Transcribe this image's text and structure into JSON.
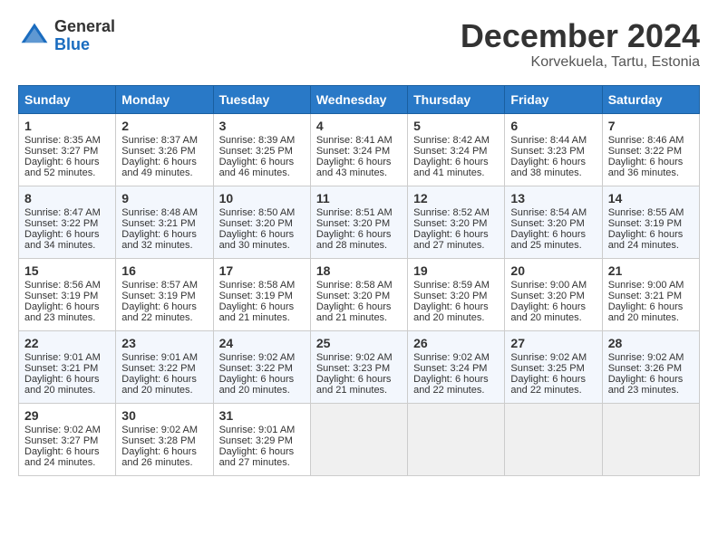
{
  "logo": {
    "general": "General",
    "blue": "Blue"
  },
  "title": "December 2024",
  "location": "Korvekuela, Tartu, Estonia",
  "days_of_week": [
    "Sunday",
    "Monday",
    "Tuesday",
    "Wednesday",
    "Thursday",
    "Friday",
    "Saturday"
  ],
  "weeks": [
    [
      {
        "day": "1",
        "sunrise": "Sunrise: 8:35 AM",
        "sunset": "Sunset: 3:27 PM",
        "daylight": "Daylight: 6 hours and 52 minutes."
      },
      {
        "day": "2",
        "sunrise": "Sunrise: 8:37 AM",
        "sunset": "Sunset: 3:26 PM",
        "daylight": "Daylight: 6 hours and 49 minutes."
      },
      {
        "day": "3",
        "sunrise": "Sunrise: 8:39 AM",
        "sunset": "Sunset: 3:25 PM",
        "daylight": "Daylight: 6 hours and 46 minutes."
      },
      {
        "day": "4",
        "sunrise": "Sunrise: 8:41 AM",
        "sunset": "Sunset: 3:24 PM",
        "daylight": "Daylight: 6 hours and 43 minutes."
      },
      {
        "day": "5",
        "sunrise": "Sunrise: 8:42 AM",
        "sunset": "Sunset: 3:24 PM",
        "daylight": "Daylight: 6 hours and 41 minutes."
      },
      {
        "day": "6",
        "sunrise": "Sunrise: 8:44 AM",
        "sunset": "Sunset: 3:23 PM",
        "daylight": "Daylight: 6 hours and 38 minutes."
      },
      {
        "day": "7",
        "sunrise": "Sunrise: 8:46 AM",
        "sunset": "Sunset: 3:22 PM",
        "daylight": "Daylight: 6 hours and 36 minutes."
      }
    ],
    [
      {
        "day": "8",
        "sunrise": "Sunrise: 8:47 AM",
        "sunset": "Sunset: 3:22 PM",
        "daylight": "Daylight: 6 hours and 34 minutes."
      },
      {
        "day": "9",
        "sunrise": "Sunrise: 8:48 AM",
        "sunset": "Sunset: 3:21 PM",
        "daylight": "Daylight: 6 hours and 32 minutes."
      },
      {
        "day": "10",
        "sunrise": "Sunrise: 8:50 AM",
        "sunset": "Sunset: 3:20 PM",
        "daylight": "Daylight: 6 hours and 30 minutes."
      },
      {
        "day": "11",
        "sunrise": "Sunrise: 8:51 AM",
        "sunset": "Sunset: 3:20 PM",
        "daylight": "Daylight: 6 hours and 28 minutes."
      },
      {
        "day": "12",
        "sunrise": "Sunrise: 8:52 AM",
        "sunset": "Sunset: 3:20 PM",
        "daylight": "Daylight: 6 hours and 27 minutes."
      },
      {
        "day": "13",
        "sunrise": "Sunrise: 8:54 AM",
        "sunset": "Sunset: 3:20 PM",
        "daylight": "Daylight: 6 hours and 25 minutes."
      },
      {
        "day": "14",
        "sunrise": "Sunrise: 8:55 AM",
        "sunset": "Sunset: 3:19 PM",
        "daylight": "Daylight: 6 hours and 24 minutes."
      }
    ],
    [
      {
        "day": "15",
        "sunrise": "Sunrise: 8:56 AM",
        "sunset": "Sunset: 3:19 PM",
        "daylight": "Daylight: 6 hours and 23 minutes."
      },
      {
        "day": "16",
        "sunrise": "Sunrise: 8:57 AM",
        "sunset": "Sunset: 3:19 PM",
        "daylight": "Daylight: 6 hours and 22 minutes."
      },
      {
        "day": "17",
        "sunrise": "Sunrise: 8:58 AM",
        "sunset": "Sunset: 3:19 PM",
        "daylight": "Daylight: 6 hours and 21 minutes."
      },
      {
        "day": "18",
        "sunrise": "Sunrise: 8:58 AM",
        "sunset": "Sunset: 3:20 PM",
        "daylight": "Daylight: 6 hours and 21 minutes."
      },
      {
        "day": "19",
        "sunrise": "Sunrise: 8:59 AM",
        "sunset": "Sunset: 3:20 PM",
        "daylight": "Daylight: 6 hours and 20 minutes."
      },
      {
        "day": "20",
        "sunrise": "Sunrise: 9:00 AM",
        "sunset": "Sunset: 3:20 PM",
        "daylight": "Daylight: 6 hours and 20 minutes."
      },
      {
        "day": "21",
        "sunrise": "Sunrise: 9:00 AM",
        "sunset": "Sunset: 3:21 PM",
        "daylight": "Daylight: 6 hours and 20 minutes."
      }
    ],
    [
      {
        "day": "22",
        "sunrise": "Sunrise: 9:01 AM",
        "sunset": "Sunset: 3:21 PM",
        "daylight": "Daylight: 6 hours and 20 minutes."
      },
      {
        "day": "23",
        "sunrise": "Sunrise: 9:01 AM",
        "sunset": "Sunset: 3:22 PM",
        "daylight": "Daylight: 6 hours and 20 minutes."
      },
      {
        "day": "24",
        "sunrise": "Sunrise: 9:02 AM",
        "sunset": "Sunset: 3:22 PM",
        "daylight": "Daylight: 6 hours and 20 minutes."
      },
      {
        "day": "25",
        "sunrise": "Sunrise: 9:02 AM",
        "sunset": "Sunset: 3:23 PM",
        "daylight": "Daylight: 6 hours and 21 minutes."
      },
      {
        "day": "26",
        "sunrise": "Sunrise: 9:02 AM",
        "sunset": "Sunset: 3:24 PM",
        "daylight": "Daylight: 6 hours and 22 minutes."
      },
      {
        "day": "27",
        "sunrise": "Sunrise: 9:02 AM",
        "sunset": "Sunset: 3:25 PM",
        "daylight": "Daylight: 6 hours and 22 minutes."
      },
      {
        "day": "28",
        "sunrise": "Sunrise: 9:02 AM",
        "sunset": "Sunset: 3:26 PM",
        "daylight": "Daylight: 6 hours and 23 minutes."
      }
    ],
    [
      {
        "day": "29",
        "sunrise": "Sunrise: 9:02 AM",
        "sunset": "Sunset: 3:27 PM",
        "daylight": "Daylight: 6 hours and 24 minutes."
      },
      {
        "day": "30",
        "sunrise": "Sunrise: 9:02 AM",
        "sunset": "Sunset: 3:28 PM",
        "daylight": "Daylight: 6 hours and 26 minutes."
      },
      {
        "day": "31",
        "sunrise": "Sunrise: 9:01 AM",
        "sunset": "Sunset: 3:29 PM",
        "daylight": "Daylight: 6 hours and 27 minutes."
      },
      null,
      null,
      null,
      null
    ]
  ]
}
